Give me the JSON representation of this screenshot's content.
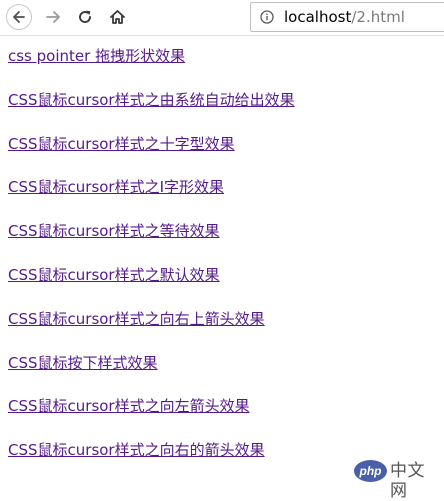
{
  "browser": {
    "back_icon": "arrow-left-icon",
    "forward_icon": "arrow-right-icon",
    "reload_icon": "reload-icon",
    "home_icon": "home-icon",
    "info_icon": "info-icon",
    "address": {
      "host": "localhost",
      "path": "/2.html"
    }
  },
  "links": [
    "css pointer 拖拽形状效果",
    "CSS鼠标cursor样式之由系统自动给出效果",
    "CSS鼠标cursor样式之十字型效果",
    "CSS鼠标cursor样式之I字形效果",
    "CSS鼠标cursor样式之等待效果",
    "CSS鼠标cursor样式之默认效果",
    "CSS鼠标cursor样式之向右上箭头效果",
    "CSS鼠标按下样式效果",
    "CSS鼠标cursor样式之向左箭头效果",
    "CSS鼠标cursor样式之向右的箭头效果"
  ],
  "colors": {
    "visited_link": "#551a8b"
  },
  "watermark": {
    "badge": "php",
    "text": "中文网"
  }
}
